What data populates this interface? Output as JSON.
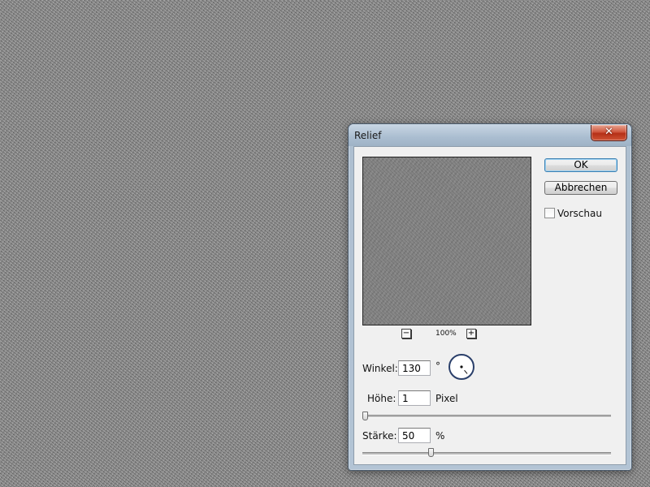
{
  "dialog": {
    "title": "Relief",
    "close_glyph": "✕",
    "ok_label": "OK",
    "cancel_label": "Abbrechen",
    "preview_checkbox_label": "Vorschau",
    "preview_checked": false,
    "zoom": {
      "minus": "−",
      "plus": "+",
      "level": "100%"
    },
    "angle": {
      "label": "Winkel:",
      "value": "130",
      "unit": "°"
    },
    "height": {
      "label": "Höhe:",
      "value": "1",
      "unit": "Pixel",
      "slider_fraction": 0.0
    },
    "strength": {
      "label": "Stärke:",
      "value": "50",
      "unit": "%",
      "slider_fraction": 0.27
    }
  },
  "icons": {
    "close": "close-icon",
    "angle_dial": "angle-dial-icon",
    "zoom_out": "minus-icon",
    "zoom_in": "plus-icon"
  },
  "colors": {
    "close_button": "#c9432a",
    "default_button_border": "#3c7fb1",
    "dialog_frame": "#aebfd0"
  }
}
